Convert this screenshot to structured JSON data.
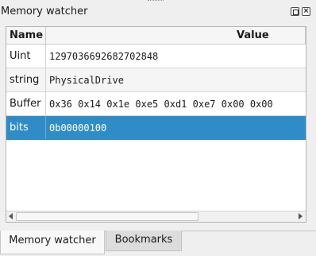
{
  "dock": {
    "title": "Memory watcher",
    "float_icon": "float-icon",
    "close_icon": "close-icon",
    "close_glyph": "×"
  },
  "table": {
    "headers": {
      "name": "Name",
      "value": "Value"
    },
    "rows": [
      {
        "name": "Uint",
        "value": "1297036692682702848"
      },
      {
        "name": "string",
        "value": "PhysicalDrive"
      },
      {
        "name": "Buffer",
        "value": "0x36 0x14 0x1e 0xe5 0xd1 0xe7 0x00 0x00"
      },
      {
        "name": "bits",
        "value": "0b00000100"
      }
    ],
    "selected_row": 3
  },
  "tabs": [
    {
      "label": "Memory watcher",
      "active": true
    },
    {
      "label": "Bookmarks",
      "active": false
    }
  ],
  "colors": {
    "selection": "#308cc6",
    "selection_text": "#ffffff"
  }
}
